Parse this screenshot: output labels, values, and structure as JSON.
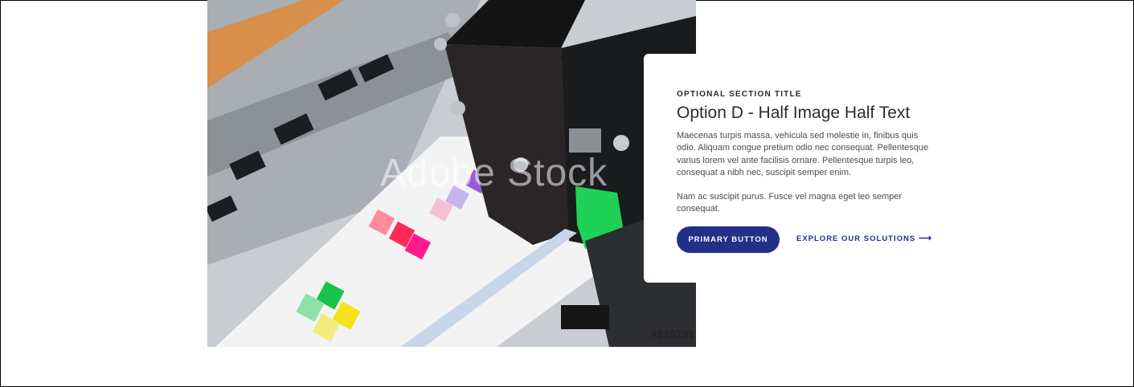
{
  "hero": {
    "watermark": "Adobe Stock",
    "stock_id": "#220291"
  },
  "section": {
    "eyebrow": "OPTIONAL SECTION TITLE",
    "heading": "Option D - Half Image Half Text",
    "paragraph_1": "Maecenas turpis massa, vehicula sed molestie in, finibus quis odio. Aliquam congue pretium odio nec consequat. Pellentesque varius lorem vel ante facilisis ornare. Pellentesque turpis leo, consequat a nibh nec, suscipit semper enim.",
    "paragraph_2": "Nam ac suscipit purus. Fusce vel magna eget leo semper consequat.",
    "primary_button": "PRIMARY BUTTON",
    "secondary_link": "EXPLORE OUR SOLUTIONS",
    "secondary_link_icon": "arrow-right-icon"
  },
  "colors": {
    "primary": "#22308a",
    "text": "#2b2b33"
  }
}
